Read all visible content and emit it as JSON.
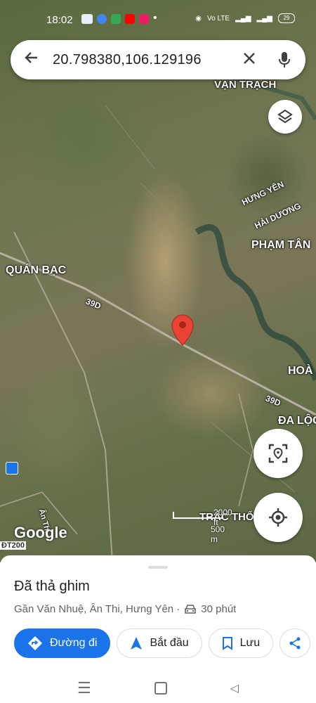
{
  "status_bar": {
    "time": "18:02",
    "battery": "29"
  },
  "search": {
    "query": "20.798380,106.129196"
  },
  "map": {
    "labels": {
      "van_trach": "VẠN TRẠCH",
      "hung_yen": "HƯNG YÊN",
      "hai_duong": "HẢI DƯƠNG",
      "pham_tan": "PHẠM TÂN",
      "quan_bac": "QUÁN BẠC",
      "road_39d_a": "39D",
      "road_39d_b": "39D",
      "hoan": "HOÀ",
      "da_loc": "ĐA LỘC",
      "trac_tho": "TRÁC THỔ",
      "an_thi": "Ân Thi",
      "dt200": "ĐT200"
    },
    "scale": {
      "top": "2000 ft",
      "bottom": "500 m"
    },
    "google_logo": "Google"
  },
  "sheet": {
    "title": "Đã thả ghim",
    "subtitle": "Gần Văn Nhuệ, Ân Thi, Hưng Yên ·",
    "drive_time": "30 phút",
    "actions": {
      "directions": "Đường đi",
      "start": "Bắt đầu",
      "save": "Lưu"
    }
  },
  "colors": {
    "accent": "#1a73e8",
    "pin": "#ea4335"
  }
}
